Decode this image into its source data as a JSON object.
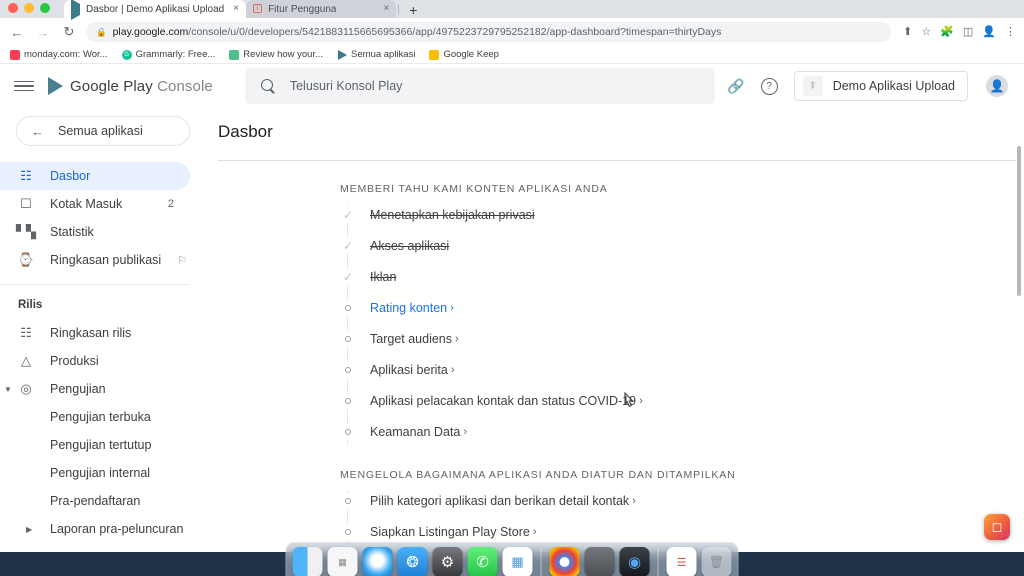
{
  "browser": {
    "tabs": [
      {
        "title": "Dasbor | Demo Aplikasi Upload",
        "active": true,
        "favicon": "play-console-icon"
      },
      {
        "title": "Fitur Pengguna",
        "active": false,
        "favicon": "red-square-icon"
      }
    ],
    "new_tab_label": "+",
    "close_label": "×",
    "nav": {
      "back": "←",
      "forward": "→",
      "reload": "↻"
    },
    "omnibox": {
      "lock_icon": "lock-icon",
      "host": "play.google.com",
      "path": "/console/u/0/developers/5421883115665695366/app/4975223729795252182/app-dashboard?timespan=thirtyDays"
    },
    "toolbar_icons": [
      "share-icon",
      "bookmark-star-icon",
      "extensions-puzzle-icon",
      "side-panel-icon",
      "profile-avatar-icon",
      "three-dot-menu-icon"
    ],
    "bookmarks": [
      {
        "label": "monday.com: Wor...",
        "color": "#ff3d57"
      },
      {
        "label": "Grammarly: Free...",
        "color": "#15c39a"
      },
      {
        "label": "Review how your...",
        "color": "#4ec08c"
      },
      {
        "label": "Semua aplikasi",
        "color": "#3d7a8c"
      },
      {
        "label": "Google Keep",
        "color": "#fbbc04"
      }
    ]
  },
  "console": {
    "brand": {
      "strong": "Google Play",
      "light": "Console"
    },
    "search": {
      "placeholder": "Telusuri Konsol Play",
      "icon": "search-icon"
    },
    "header_right": {
      "link_icon": "link-icon",
      "help_icon": "help-circle-icon",
      "app_chip": {
        "label": "Demo Aplikasi Upload",
        "icon": "app-box-icon"
      },
      "avatar": "user-avatar"
    },
    "all_apps_button": {
      "label": "Semua aplikasi",
      "icon": "arrow-back-icon"
    },
    "sidebar": {
      "items": [
        {
          "label": "Dasbor",
          "icon": "dashboard-grid-icon",
          "active": true,
          "badge": "",
          "trail": ""
        },
        {
          "label": "Kotak Masuk",
          "icon": "inbox-icon",
          "active": false,
          "badge": "2",
          "trail": ""
        },
        {
          "label": "Statistik",
          "icon": "bar-chart-icon",
          "active": false,
          "badge": "",
          "trail": ""
        },
        {
          "label": "Ringkasan publikasi",
          "icon": "publishing-clock-icon",
          "active": false,
          "badge": "",
          "trail": "flag-off-icon"
        }
      ],
      "section_label": "Rilis",
      "release_items": [
        {
          "label": "Ringkasan rilis",
          "icon": "release-grid-icon",
          "sub": false,
          "caret": ""
        },
        {
          "label": "Produksi",
          "icon": "production-rocket-icon",
          "sub": false,
          "caret": ""
        },
        {
          "label": "Pengujian",
          "icon": "testing-play-icon",
          "sub": false,
          "caret": "▼"
        },
        {
          "label": "Pengujian terbuka",
          "icon": "",
          "sub": true,
          "caret": ""
        },
        {
          "label": "Pengujian tertutup",
          "icon": "",
          "sub": true,
          "caret": ""
        },
        {
          "label": "Pengujian internal",
          "icon": "",
          "sub": true,
          "caret": ""
        },
        {
          "label": "Pra-pendaftaran",
          "icon": "",
          "sub": true,
          "caret": ""
        },
        {
          "label": "Laporan pra-peluncuran",
          "icon": "",
          "sub": true,
          "caret": "▶"
        }
      ]
    },
    "page_title": "Dasbor",
    "sections": [
      {
        "heading": "MEMBERI TAHU KAMI KONTEN APLIKASI ANDA",
        "items": [
          {
            "label": "Menetapkan kebijakan privasi",
            "state": "done",
            "chevron": ""
          },
          {
            "label": "Akses aplikasi",
            "state": "done",
            "chevron": ""
          },
          {
            "label": "Iklan",
            "state": "done",
            "chevron": ""
          },
          {
            "label": "Rating konten",
            "state": "link",
            "chevron": "›"
          },
          {
            "label": "Target audiens",
            "state": "todo",
            "chevron": "›"
          },
          {
            "label": "Aplikasi berita",
            "state": "todo",
            "chevron": "›"
          },
          {
            "label": "Aplikasi pelacakan kontak dan status COVID-19",
            "state": "todo",
            "chevron": "›"
          },
          {
            "label": "Keamanan Data",
            "state": "todo",
            "chevron": "›"
          }
        ]
      },
      {
        "heading": "MENGELOLA BAGAIMANA APLIKASI ANDA DIATUR DAN DITAMPILKAN",
        "items": [
          {
            "label": "Pilih kategori aplikasi dan berikan detail kontak",
            "state": "todo",
            "chevron": "›"
          },
          {
            "label": "Siapkan Listingan Play Store",
            "state": "todo",
            "chevron": "›"
          }
        ]
      }
    ]
  },
  "dock": {
    "icons": [
      {
        "name": "finder-icon",
        "glyph": "",
        "bg": "linear-gradient(180deg,#4fb3f7 0%,#2f8fd8 50%,#f2f2f2 50%,#e2e2e2 100%)"
      },
      {
        "name": "launchpad-icon",
        "glyph": "",
        "bg": "#f4f4f6"
      },
      {
        "name": "safari-icon",
        "glyph": "",
        "bg": "radial-gradient(circle at 50% 45%,#ffffff 30%,#2b9fe8 65%,#1b6fb5 100%)"
      },
      {
        "name": "xcode-icon",
        "glyph": "",
        "bg": "linear-gradient(180deg,#3fa9f5 0%,#1e7fd4 100%)"
      },
      {
        "name": "system-settings-icon",
        "glyph": "",
        "bg": "linear-gradient(180deg,#6e6e73 0%,#3a3a3c 100%)"
      },
      {
        "name": "whatsapp-icon",
        "glyph": "",
        "bg": "linear-gradient(180deg,#5ef07a 0%,#25c84a 100%)"
      },
      {
        "name": "slack-icon",
        "glyph": "",
        "bg": "#ffffff"
      },
      {
        "name": "divider",
        "glyph": "",
        "bg": ""
      },
      {
        "name": "chrome-icon",
        "glyph": "",
        "bg": "#ffffff"
      },
      {
        "name": "preview-icon",
        "glyph": "",
        "bg": "linear-gradient(180deg,#6f7377 0%,#4c5053 100%)"
      },
      {
        "name": "zoom-icon",
        "glyph": "",
        "bg": "linear-gradient(180deg,#3b3f45 0%,#16191d 100%)"
      },
      {
        "name": "divider2",
        "glyph": "",
        "bg": ""
      },
      {
        "name": "reminders-icon",
        "glyph": "",
        "bg": "#ffffff"
      },
      {
        "name": "trash-icon",
        "glyph": "",
        "bg": "rgba(230,232,235,.55)"
      }
    ],
    "float_badge": {
      "name": "recorder-badge-icon",
      "glyph": "⬚"
    }
  }
}
